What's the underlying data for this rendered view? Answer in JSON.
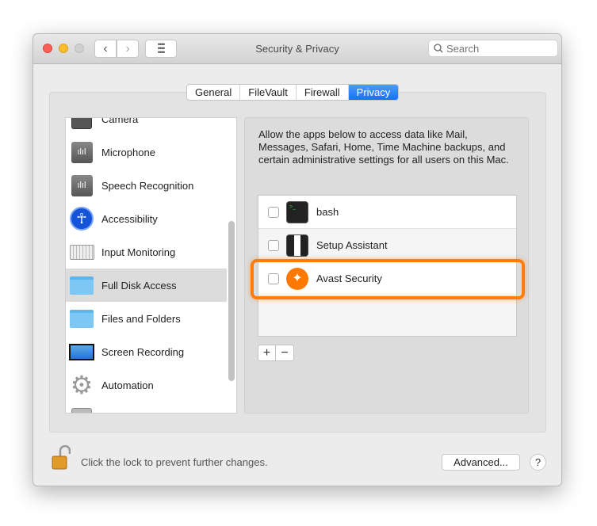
{
  "window": {
    "title": "Security & Privacy"
  },
  "toolbar": {
    "search_placeholder": "Search"
  },
  "tabs": [
    {
      "label": "General"
    },
    {
      "label": "FileVault"
    },
    {
      "label": "Firewall"
    },
    {
      "label": "Privacy",
      "active": true
    }
  ],
  "sidebar": {
    "items": [
      {
        "label": "Camera",
        "icon": "camera-icon"
      },
      {
        "label": "Microphone",
        "icon": "microphone-icon"
      },
      {
        "label": "Speech Recognition",
        "icon": "speech-icon"
      },
      {
        "label": "Accessibility",
        "icon": "accessibility-icon"
      },
      {
        "label": "Input Monitoring",
        "icon": "keyboard-icon"
      },
      {
        "label": "Full Disk Access",
        "icon": "folder-icon",
        "selected": true
      },
      {
        "label": "Files and Folders",
        "icon": "folder-icon"
      },
      {
        "label": "Screen Recording",
        "icon": "display-icon"
      },
      {
        "label": "Automation",
        "icon": "gear-icon"
      }
    ]
  },
  "main": {
    "description": "Allow the apps below to access data like Mail, Messages, Safari, Home, Time Machine backups, and certain administrative settings for all users on this Mac.",
    "apps": [
      {
        "name": "bash",
        "checked": false,
        "icon": "terminal-icon"
      },
      {
        "name": "Setup Assistant",
        "checked": false,
        "icon": "tuxedo-icon"
      },
      {
        "name": "Avast Security",
        "checked": false,
        "icon": "avast-icon",
        "highlighted": true
      }
    ],
    "add_label": "+",
    "remove_label": "−"
  },
  "footer": {
    "lock_text": "Click the lock to prevent further changes.",
    "advanced_label": "Advanced...",
    "help_label": "?"
  },
  "colors": {
    "accent": "#1a6ef5",
    "highlight": "#ff7d0f",
    "avast": "#ff7800"
  }
}
